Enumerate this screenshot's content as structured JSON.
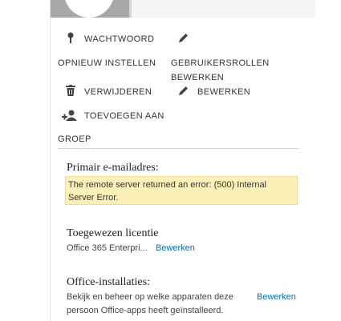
{
  "header": {
    "avatar": "user-photo-placeholder"
  },
  "actions": {
    "password": {
      "line1": "WACHTWOORD",
      "line2": "OPNIEUW INSTELLEN",
      "icon": "key-icon"
    },
    "roles": {
      "line1": "GEBRUIKERSROLLEN",
      "line2": "BEWERKEN",
      "icon": "pencil-icon"
    },
    "delete": {
      "label": "VERWIJDEREN",
      "icon": "trash-icon"
    },
    "edit": {
      "label": "BEWERKEN",
      "icon": "pencil-icon"
    },
    "add_group": {
      "line1": "TOEVOEGEN AAN",
      "line2": "GROEP",
      "icon": "add-user-icon"
    }
  },
  "primary_email": {
    "heading": "Primair e-mailadres:",
    "error_line1": "The remote server returned an error: (500) Internal",
    "error_line2": "Server Error."
  },
  "license": {
    "heading": "Toegewezen licentie",
    "value": "Office 365 Enterpri...",
    "edit_link": "Bewerken"
  },
  "office": {
    "heading": "Office-installaties:",
    "line1": "Bekijk en beheer op welke apparaten deze",
    "line2": "persoon Office-apps heeft geïnstalleerd.",
    "edit_link": "Bewerken"
  },
  "colors": {
    "link": "#0072c6",
    "error_bg": "#fdf0b7"
  }
}
